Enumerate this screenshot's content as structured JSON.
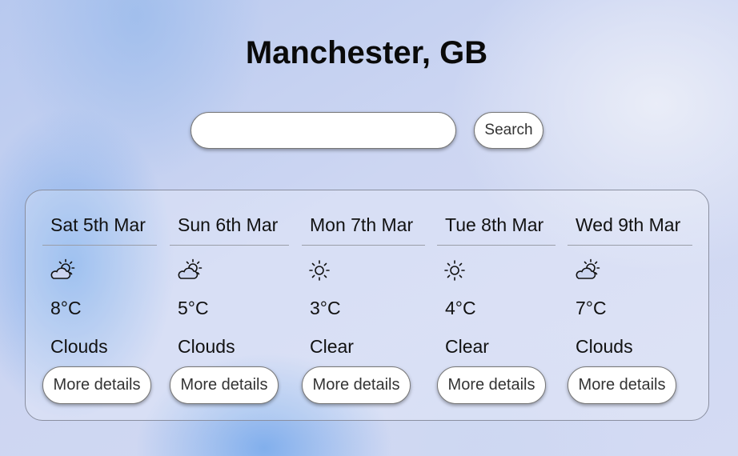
{
  "header": {
    "location": "Manchester, GB"
  },
  "search": {
    "value": "",
    "button_label": "Search"
  },
  "forecast": {
    "days": [
      {
        "date": "Sat 5th Mar",
        "icon": "partly-cloudy-sun-icon",
        "temp": "8°C",
        "condition": "Clouds",
        "button_label": "More details"
      },
      {
        "date": "Sun 6th Mar",
        "icon": "partly-cloudy-sun-icon",
        "temp": "5°C",
        "condition": "Clouds",
        "button_label": "More details"
      },
      {
        "date": "Mon 7th Mar",
        "icon": "sun-icon",
        "temp": "3°C",
        "condition": "Clear",
        "button_label": "More details"
      },
      {
        "date": "Tue 8th Mar",
        "icon": "sun-icon",
        "temp": "4°C",
        "condition": "Clear",
        "button_label": "More details"
      },
      {
        "date": "Wed 9th Mar",
        "icon": "partly-cloudy-sun-icon",
        "temp": "7°C",
        "condition": "Clouds",
        "button_label": "More details"
      }
    ]
  }
}
